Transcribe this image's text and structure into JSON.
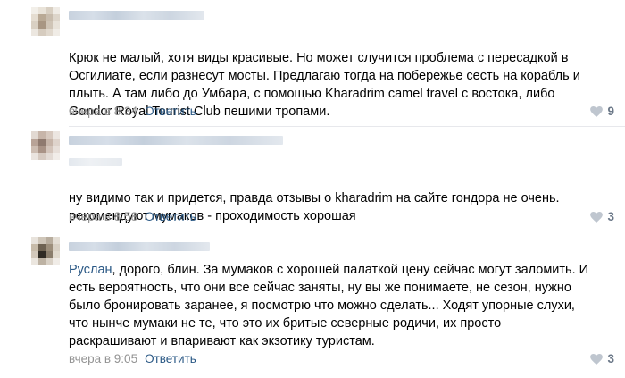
{
  "comments": [
    {
      "mention": "",
      "text": "Крюк не малый, хотя виды красивые. Но может случится проблема с пересадкой в\nОсгилиате, если разнесут мосты. Предлагаю тогда на побережье сесть на корабль и\nплыть. А там либо до Умбара, с помощью Kharadrim camel travel с востока, либо\nGondor Royal Tourist Club пешими тропами.",
      "time": "вчера в 8:34",
      "reply_label": "Ответить",
      "likes": "9",
      "like_icon": "heart-icon"
    },
    {
      "mention": "",
      "text": "ну видимо так и придется, правда отзывы о kharadrim на сайте гондора не очень.\nрекомендуют мумаков - проходимость хорошая",
      "time": "вчера в 8:58",
      "reply_label": "Ответить",
      "likes": "3",
      "like_icon": "heart-icon"
    },
    {
      "mention": "Руслан",
      "text": ", дорого, блин. За мумаков с хорошей палаткой цену сейчас могут заломить. И\nесть вероятность, что они все сейчас заняты, ну вы же понимаете, не сезон, нужно\nбыло бронировать заранее, я посмотрю что можно сделать... Ходят упорные слухи,\nчто нынче мумаки не те, что это их бритые северные родичи, их просто\nраскрашивают и впаривают как экзотику туристам.",
      "time": "вчера в 9:05",
      "reply_label": "Ответить",
      "likes": "3",
      "like_icon": "heart-icon"
    }
  ],
  "colors": {
    "link": "#2a5885",
    "meta": "#939393",
    "divider": "#e7e8ec",
    "like_count": "#6a7787"
  }
}
